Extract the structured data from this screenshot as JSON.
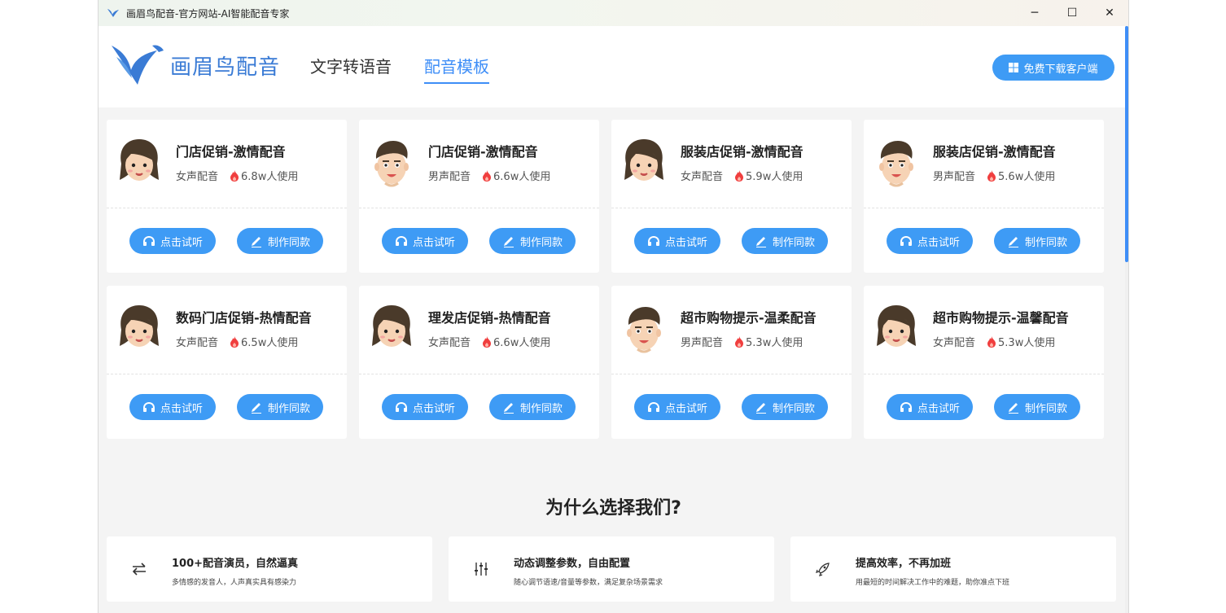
{
  "window": {
    "title": "画眉鸟配音-官方网站-AI智能配音专家",
    "controls": {
      "minimize": "─",
      "maximize": "☐",
      "close": "✕"
    }
  },
  "header": {
    "brand": "画眉鸟配音",
    "nav": [
      "文字转语音",
      "配音模板"
    ],
    "active_nav": "配音模板",
    "download_label": "免费下载客户端"
  },
  "colors": {
    "accent": "#3e9bf5",
    "fire": "#f03e3e",
    "hair": "#4a3a2a",
    "skin": "#f6d3b5"
  },
  "templates": [
    {
      "title": "门店促销-激情配音",
      "gender": "女声配音",
      "usage": "6.8w人使用",
      "avatar": "female"
    },
    {
      "title": "门店促销-激情配音",
      "gender": "男声配音",
      "usage": "6.6w人使用",
      "avatar": "male"
    },
    {
      "title": "服装店促销-激情配音",
      "gender": "女声配音",
      "usage": "5.9w人使用",
      "avatar": "female"
    },
    {
      "title": "服装店促销-激情配音",
      "gender": "男声配音",
      "usage": "5.6w人使用",
      "avatar": "male"
    },
    {
      "title": "数码门店促销-热情配音",
      "gender": "女声配音",
      "usage": "6.5w人使用",
      "avatar": "female"
    },
    {
      "title": "理发店促销-热情配音",
      "gender": "女声配音",
      "usage": "6.6w人使用",
      "avatar": "female"
    },
    {
      "title": "超市购物提示-温柔配音",
      "gender": "男声配音",
      "usage": "5.3w人使用",
      "avatar": "male"
    },
    {
      "title": "超市购物提示-温馨配音",
      "gender": "女声配音",
      "usage": "5.3w人使用",
      "avatar": "female"
    }
  ],
  "buttons": {
    "listen": "点击试听",
    "make": "制作同款"
  },
  "why": {
    "title": "为什么选择我们?",
    "features": [
      {
        "title": "100+配音演员，自然逼真",
        "desc": "多情感的发音人，人声真实具有感染力",
        "icon": "swap-arrows-icon"
      },
      {
        "title": "动态调整参数，自由配置",
        "desc": "随心调节语速/音量等参数，满足复杂场景需求",
        "icon": "sliders-icon"
      },
      {
        "title": "提高效率，不再加班",
        "desc": "用最短的时间解决工作中的难题，助你准点下班",
        "icon": "rocket-icon"
      }
    ]
  }
}
